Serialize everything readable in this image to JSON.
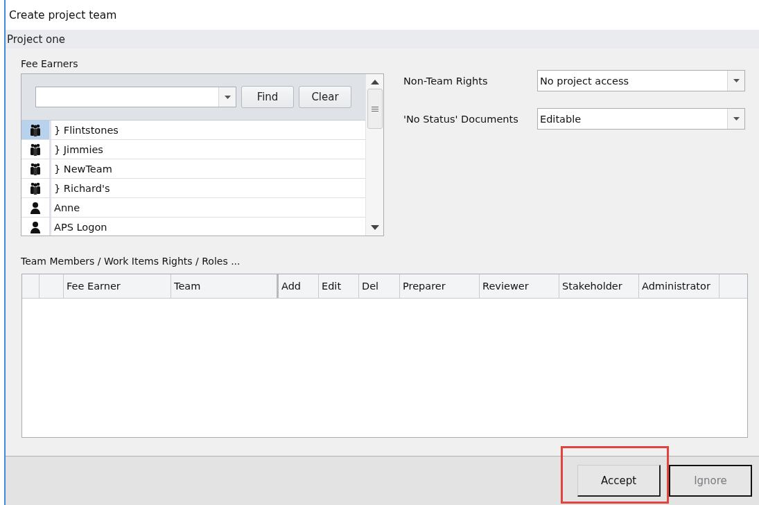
{
  "window": {
    "title": "Create project team"
  },
  "project": {
    "name": "Project one"
  },
  "fee_earners": {
    "label": "Fee Earners",
    "find_button": "Find",
    "clear_button": "Clear",
    "items": [
      {
        "kind": "team",
        "name": "} Flintstones",
        "selected": true
      },
      {
        "kind": "team",
        "name": "} Jimmies",
        "selected": false
      },
      {
        "kind": "team",
        "name": "} NewTeam",
        "selected": false
      },
      {
        "kind": "team",
        "name": "} Richard's",
        "selected": false
      },
      {
        "kind": "person",
        "name": "Anne",
        "selected": false
      },
      {
        "kind": "person",
        "name": "APS Logon",
        "selected": false
      }
    ]
  },
  "settings": [
    {
      "label": "Non-Team Rights",
      "value": "No project access"
    },
    {
      "label": "'No Status' Documents",
      "value": "Editable"
    }
  ],
  "team_members": {
    "label": "Team Members / Work Items Rights / Roles ...",
    "columns": [
      "Fee Earner",
      "Team",
      "Add",
      "Edit",
      "Del",
      "Preparer",
      "Reviewer",
      "Stakeholder",
      "Administrator"
    ]
  },
  "buttons": [
    {
      "label": "Accept",
      "disabled": false,
      "highlighted": true
    },
    {
      "label": "Ignore",
      "disabled": true,
      "highlighted": false
    }
  ]
}
